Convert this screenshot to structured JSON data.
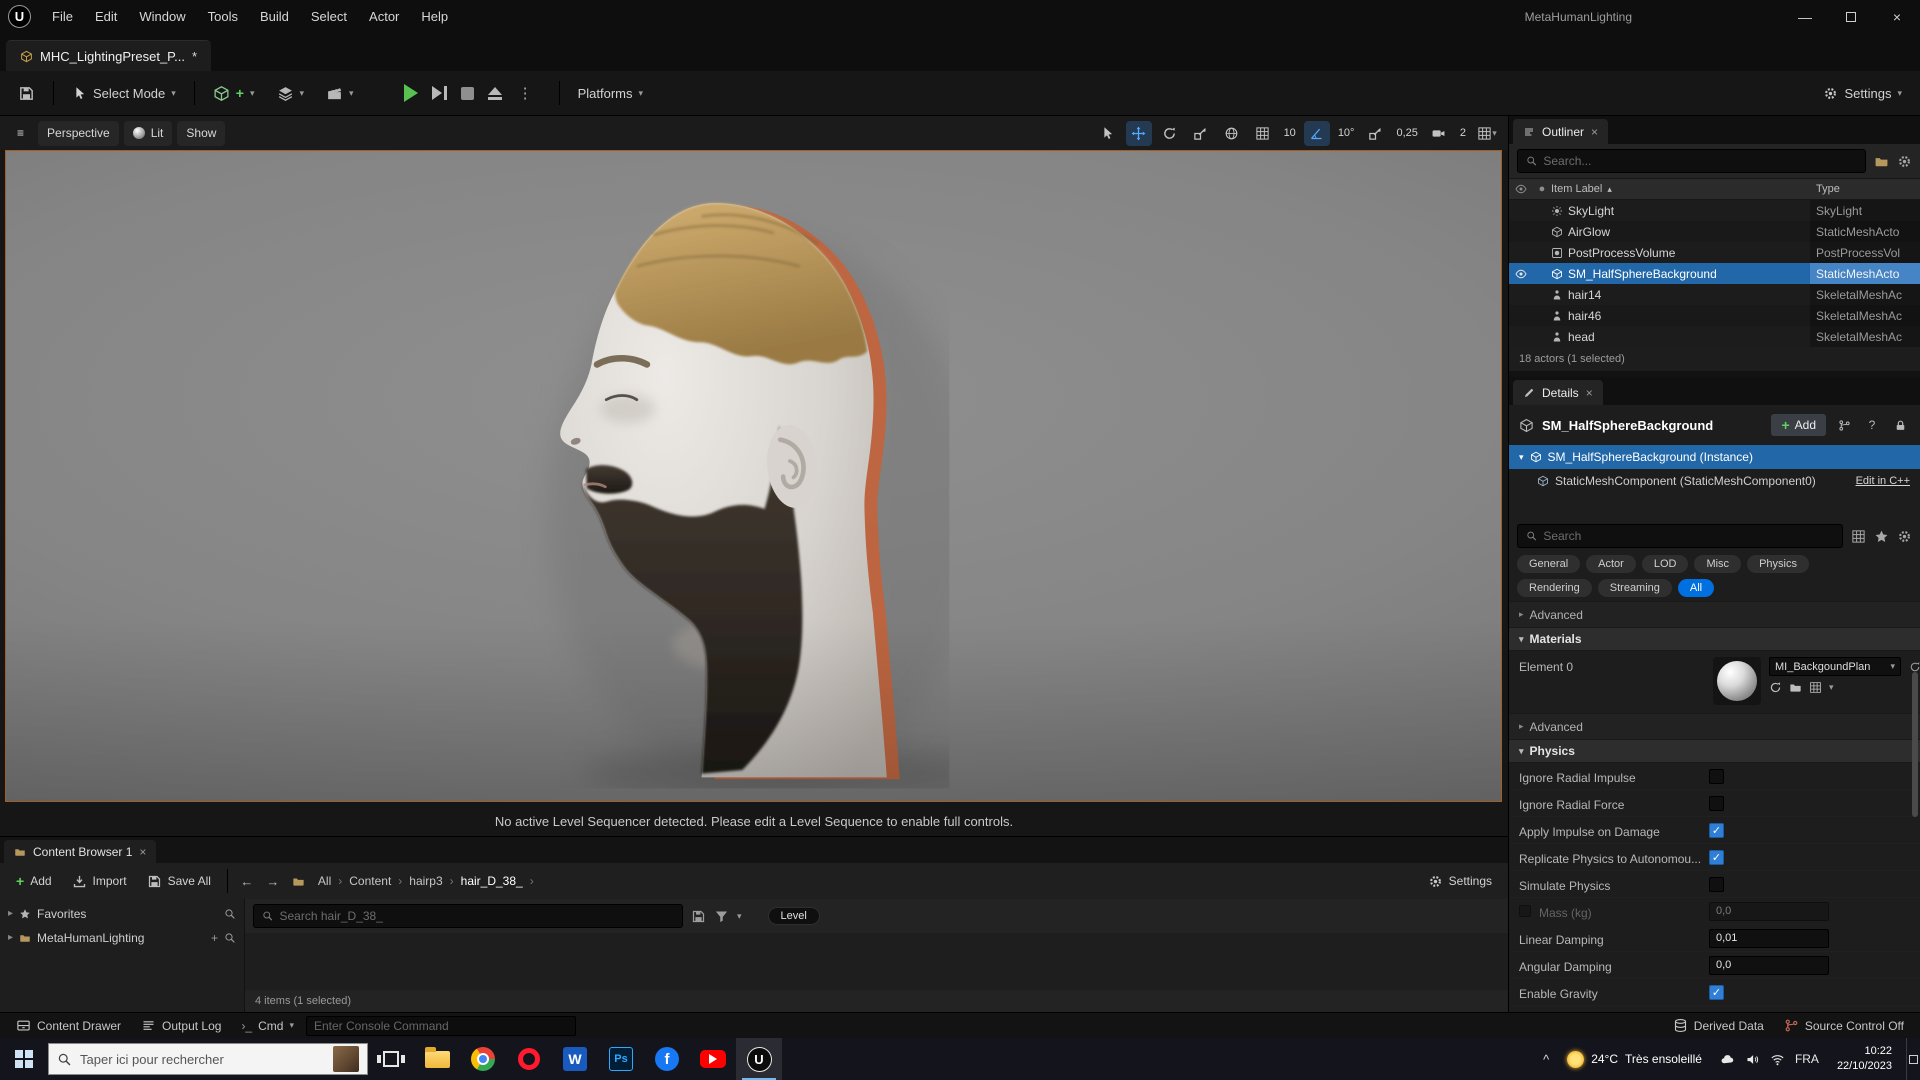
{
  "window": {
    "title": "MetaHumanLighting",
    "minimize": "—",
    "close": "×"
  },
  "menubar": {
    "items": [
      "File",
      "Edit",
      "Window",
      "Tools",
      "Build",
      "Select",
      "Actor",
      "Help"
    ]
  },
  "asset_tab": {
    "label": "MHC_LightingPreset_P...",
    "dirty": "*"
  },
  "toolbar": {
    "select_mode": "Select Mode",
    "platforms": "Platforms",
    "settings": "Settings"
  },
  "viewport": {
    "perspective": "Perspective",
    "lit": "Lit",
    "show": "Show",
    "grid_snap": "10",
    "angle_snap": "10°",
    "scale_snap": "0,25",
    "camera_speed": "2",
    "sequencer_message": "No active Level Sequencer detected. Please edit a Level Sequence to enable full controls."
  },
  "outliner": {
    "tab": "Outliner",
    "search_placeholder": "Search...",
    "col_item": "Item Label",
    "col_type": "Type",
    "rows": [
      {
        "label": "SkyLight",
        "type": "SkyLight",
        "selected": false
      },
      {
        "label": "AirGlow",
        "type": "StaticMeshActo",
        "selected": false
      },
      {
        "label": "PostProcessVolume",
        "type": "PostProcessVol",
        "selected": false
      },
      {
        "label": "SM_HalfSphereBackground",
        "type": "StaticMeshActo",
        "selected": true
      },
      {
        "label": "hair14",
        "type": "SkeletalMeshAc",
        "selected": false
      },
      {
        "label": "hair46",
        "type": "SkeletalMeshAc",
        "selected": false
      },
      {
        "label": "head",
        "type": "SkeletalMeshAc",
        "selected": false
      }
    ],
    "footer": "18 actors (1 selected)"
  },
  "details": {
    "tab": "Details",
    "object_name": "SM_HalfSphereBackground",
    "add_button": "Add",
    "instance_label": "SM_HalfSphereBackground (Instance)",
    "component_label": "StaticMeshComponent (StaticMeshComponent0)",
    "edit_cpp": "Edit in C++",
    "search_placeholder": "Search",
    "filters": [
      {
        "label": "General"
      },
      {
        "label": "Actor"
      },
      {
        "label": "LOD"
      },
      {
        "label": "Misc"
      },
      {
        "label": "Physics"
      },
      {
        "label": "Rendering"
      },
      {
        "label": "Streaming"
      },
      {
        "label": "All",
        "active": true
      }
    ],
    "advanced": "Advanced",
    "materials": {
      "header": "Materials",
      "element_label": "Element 0",
      "material_name": "MI_BackgoundPlan"
    },
    "physics": {
      "header": "Physics",
      "rows": [
        {
          "label": "Ignore Radial Impulse",
          "checked": false
        },
        {
          "label": "Ignore Radial Force",
          "checked": false
        },
        {
          "label": "Apply Impulse on Damage",
          "checked": true
        },
        {
          "label": "Replicate Physics to Autonomou...",
          "checked": true
        },
        {
          "label": "Simulate Physics",
          "checked": false
        },
        {
          "label": "Mass (kg)",
          "value": "0,0",
          "disabled": true
        },
        {
          "label": "Linear Damping",
          "value": "0,01"
        },
        {
          "label": "Angular Damping",
          "value": "0,0"
        },
        {
          "label": "Enable Gravity",
          "checked": true
        }
      ]
    }
  },
  "content_browser": {
    "tab": "Content Browser 1",
    "add": "Add",
    "import": "Import",
    "save_all": "Save All",
    "breadcrumb": [
      "All",
      "Content",
      "hairp3",
      "hair_D_38_"
    ],
    "settings": "Settings",
    "favorites": "Favorites",
    "collection": "MetaHumanLighting",
    "search_placeholder": "Search hair_D_38_",
    "level_badge": "Level",
    "status": "4 items (1 selected)"
  },
  "statusbar": {
    "content_drawer": "Content Drawer",
    "output_log": "Output Log",
    "cmd": "Cmd",
    "console_placeholder": "Enter Console Command",
    "derived_data": "Derived Data",
    "source_control": "Source Control Off"
  },
  "taskbar": {
    "search_placeholder": "Taper ici pour rechercher",
    "weather_temp": "24°C",
    "weather_desc": "Très ensoleillé",
    "language": "FRA",
    "time": "10:22",
    "date": "22/10/2023"
  },
  "colors": {
    "accent_blue": "#0070e0",
    "selection_blue": "#2268a8",
    "viewport_border": "#a05d26"
  }
}
